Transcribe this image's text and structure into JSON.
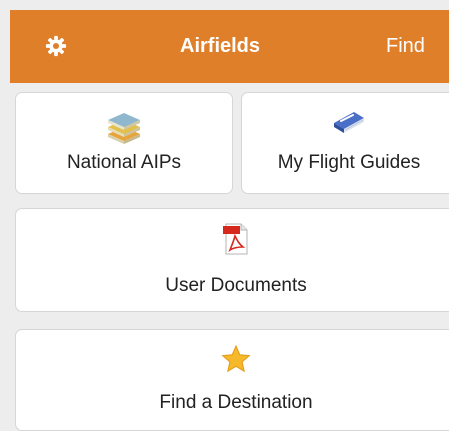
{
  "header": {
    "title": "Airfields",
    "find_label": "Find",
    "settings_icon": "gear-icon",
    "background_color": "#e07f2a",
    "text_color": "#ffffff"
  },
  "menu": {
    "national_aips": {
      "label": "National AIPs",
      "icon": "stacked-books-icon"
    },
    "flight_guides": {
      "label": "My Flight Guides",
      "icon": "blue-book-icon"
    },
    "user_documents": {
      "label": "User Documents",
      "icon": "pdf-document-icon"
    },
    "find_destination": {
      "label": "Find a Destination",
      "icon": "star-icon"
    }
  }
}
